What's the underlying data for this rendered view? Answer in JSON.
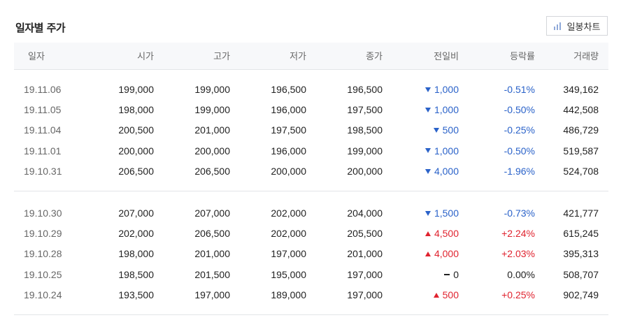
{
  "title": "일자별 주가",
  "chart_button": {
    "label": "일봉차트",
    "icon": "bar-chart-icon"
  },
  "columns": [
    "일자",
    "시가",
    "고가",
    "저가",
    "종가",
    "전일비",
    "등락률",
    "거래량"
  ],
  "colors": {
    "down": "#2a62c9",
    "up": "#e0232f",
    "flat": "#222222"
  },
  "groups": [
    [
      {
        "date": "19.11.06",
        "open": "199,000",
        "high": "199,000",
        "low": "196,500",
        "close": "196,500",
        "direction": "down",
        "change": "1,000",
        "rate": "-0.51%",
        "volume": "349,162"
      },
      {
        "date": "19.11.05",
        "open": "198,000",
        "high": "199,000",
        "low": "196,000",
        "close": "197,500",
        "direction": "down",
        "change": "1,000",
        "rate": "-0.50%",
        "volume": "442,508"
      },
      {
        "date": "19.11.04",
        "open": "200,500",
        "high": "201,000",
        "low": "197,500",
        "close": "198,500",
        "direction": "down",
        "change": "500",
        "rate": "-0.25%",
        "volume": "486,729"
      },
      {
        "date": "19.11.01",
        "open": "200,000",
        "high": "200,000",
        "low": "196,000",
        "close": "199,000",
        "direction": "down",
        "change": "1,000",
        "rate": "-0.50%",
        "volume": "519,587"
      },
      {
        "date": "19.10.31",
        "open": "206,500",
        "high": "206,500",
        "low": "200,000",
        "close": "200,000",
        "direction": "down",
        "change": "4,000",
        "rate": "-1.96%",
        "volume": "524,708"
      }
    ],
    [
      {
        "date": "19.10.30",
        "open": "207,000",
        "high": "207,000",
        "low": "202,000",
        "close": "204,000",
        "direction": "down",
        "change": "1,500",
        "rate": "-0.73%",
        "volume": "421,777"
      },
      {
        "date": "19.10.29",
        "open": "202,000",
        "high": "206,500",
        "low": "202,000",
        "close": "205,500",
        "direction": "up",
        "change": "4,500",
        "rate": "+2.24%",
        "volume": "615,245"
      },
      {
        "date": "19.10.28",
        "open": "198,000",
        "high": "201,000",
        "low": "197,000",
        "close": "201,000",
        "direction": "up",
        "change": "4,000",
        "rate": "+2.03%",
        "volume": "395,313"
      },
      {
        "date": "19.10.25",
        "open": "198,500",
        "high": "201,500",
        "low": "195,000",
        "close": "197,000",
        "direction": "flat",
        "change": "0",
        "rate": "0.00%",
        "volume": "508,707"
      },
      {
        "date": "19.10.24",
        "open": "193,500",
        "high": "197,000",
        "low": "189,000",
        "close": "197,000",
        "direction": "up",
        "change": "500",
        "rate": "+0.25%",
        "volume": "902,749"
      }
    ]
  ]
}
